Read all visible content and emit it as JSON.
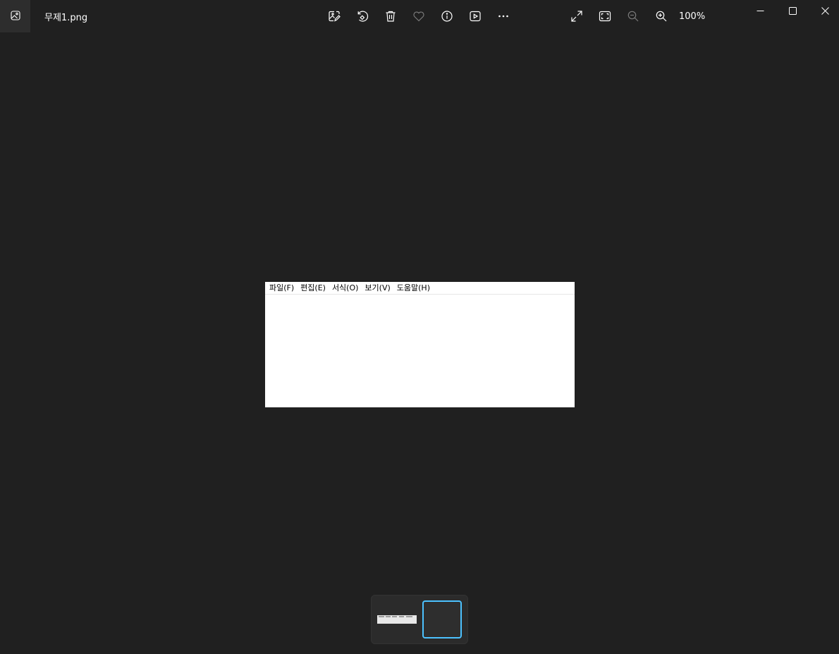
{
  "window": {
    "file_name": "무제1.png",
    "zoom_level": "100%"
  },
  "toolbar": {
    "icons": [
      "edit-image-icon",
      "rotate-icon",
      "delete-icon",
      "favorite-icon",
      "info-icon",
      "slideshow-icon",
      "more-icon"
    ],
    "view_icons": [
      "full-screen-icon",
      "fit-to-window-icon",
      "zoom-out-icon",
      "zoom-in-icon"
    ]
  },
  "window_controls": [
    "minimize-icon",
    "maximize-icon",
    "close-icon"
  ],
  "image": {
    "menu_items": [
      "파일(F)",
      "편집(E)",
      "서식(O)",
      "보기(V)",
      "도움말(H)"
    ]
  },
  "filmstrip": {
    "count": 2,
    "selected_index": 1
  },
  "colors": {
    "background": "#202020",
    "accent": "#4cc2ff",
    "icon": "#ffffff",
    "icon_disabled": "#7a7a7a"
  }
}
